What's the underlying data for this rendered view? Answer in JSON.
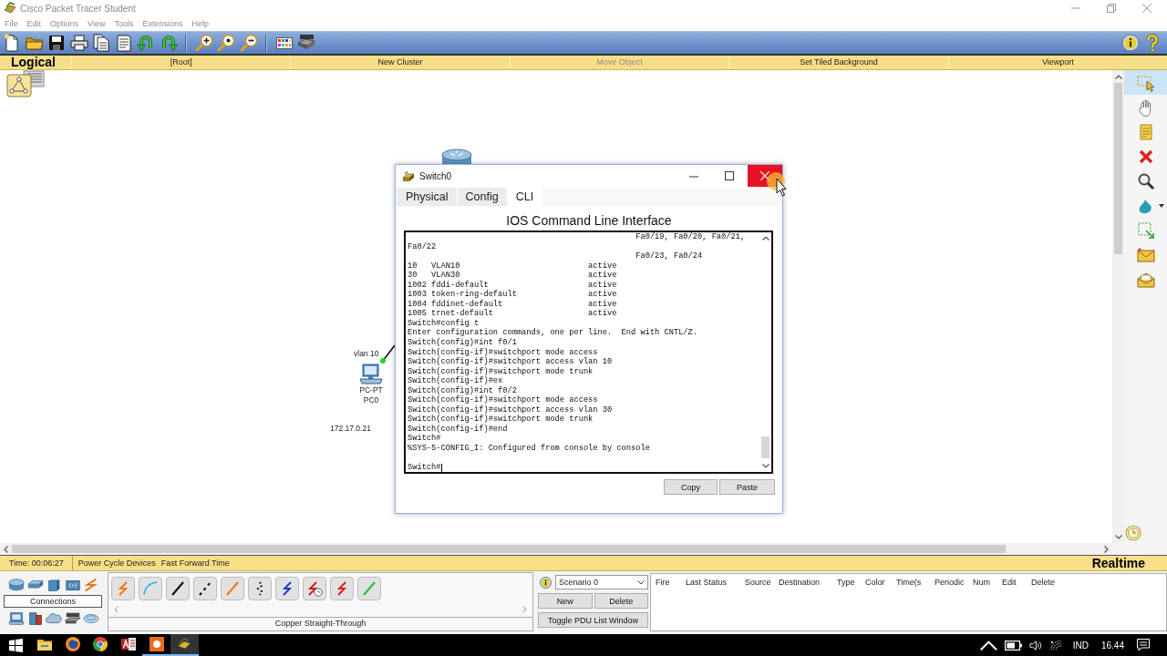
{
  "window": {
    "title": "Cisco Packet Tracer Student"
  },
  "menu": [
    "File",
    "Edit",
    "Options",
    "View",
    "Tools",
    "Extensions",
    "Help"
  ],
  "workspace_bar": {
    "mode_tab": "Logical",
    "items": [
      {
        "label": "[Root]",
        "disabled": false
      },
      {
        "label": "New Cluster",
        "disabled": false
      },
      {
        "label": "Move Object",
        "disabled": true
      },
      {
        "label": "Set Tiled Background",
        "disabled": false
      },
      {
        "label": "Viewport",
        "disabled": false
      }
    ]
  },
  "canvas": {
    "link_note": "vlan 10",
    "pc": {
      "model": "PC-PT",
      "name": "PC0"
    },
    "address_note": "172.17.0.21"
  },
  "tool_palette": [
    {
      "kind": "select",
      "selected": true
    },
    {
      "kind": "move",
      "selected": false
    },
    {
      "kind": "note",
      "selected": false
    },
    {
      "kind": "delete",
      "selected": false
    },
    {
      "kind": "inspect",
      "selected": false
    },
    {
      "kind": "draw",
      "selected": false
    },
    {
      "kind": "resize",
      "selected": false
    },
    {
      "kind": "simple-pdu",
      "selected": false
    },
    {
      "kind": "complex-pdu",
      "selected": false
    }
  ],
  "dialog": {
    "title": "Switch0",
    "tabs": [
      {
        "label": "Physical",
        "selected": false
      },
      {
        "label": "Config",
        "selected": false
      },
      {
        "label": "CLI",
        "selected": true
      }
    ],
    "heading": "IOS Command Line Interface",
    "console_lines": [
      "                                                Fa0/19, Fa0/20, Fa0/21,",
      "Fa0/22",
      "                                                Fa0/23, Fa0/24",
      "10   VLAN10                           active",
      "30   VLAN30                           active",
      "1002 fddi-default                     active",
      "1003 token-ring-default               active",
      "1004 fddinet-default                  active",
      "1005 trnet-default                    active",
      "Switch#config t",
      "Enter configuration commands, one per line.  End with CNTL/Z.",
      "Switch(config)#int f0/1",
      "Switch(config-if)#switchport mode access",
      "Switch(config-if)#switchport access vlan 10",
      "Switch(config-if)#switchport mode trunk",
      "Switch(config-if)#ex",
      "Switch(config)#int f0/2",
      "Switch(config-if)#switchport mode access",
      "Switch(config-if)#switchport access vlan 30",
      "Switch(config-if)#switchport mode trunk",
      "Switch(config-if)#end",
      "Switch#",
      "%SYS-5-CONFIG_I: Configured from console by console"
    ],
    "prompt": "Switch#",
    "buttons": [
      "Copy",
      "Paste"
    ]
  },
  "status_bar": {
    "time": "Time: 00:06:27",
    "buttons": [
      "Power Cycle Devices",
      "Fast Forward Time"
    ],
    "mode_tab": "Realtime"
  },
  "device_types": {
    "top_row": [
      {
        "kind": "router"
      },
      {
        "kind": "switch"
      },
      {
        "kind": "hub"
      },
      {
        "kind": "wireless"
      },
      {
        "kind": "connection"
      }
    ],
    "label": "Connections",
    "bottom_row": [
      {
        "kind": "end-device"
      },
      {
        "kind": "security"
      },
      {
        "kind": "wan"
      },
      {
        "kind": "custom"
      },
      {
        "kind": "multiuser"
      }
    ]
  },
  "cables": {
    "items": [
      {
        "kind": "automatic"
      },
      {
        "kind": "console"
      },
      {
        "kind": "copper-straight"
      },
      {
        "kind": "copper-cross"
      },
      {
        "kind": "fiber"
      },
      {
        "kind": "phone"
      },
      {
        "kind": "coaxial"
      },
      {
        "kind": "serial-dce"
      },
      {
        "kind": "serial-dte"
      },
      {
        "kind": "usb"
      }
    ],
    "name": "Copper Straight-Through"
  },
  "scenario": {
    "select": "Scenario 0",
    "buttons": [
      "New",
      "Delete",
      "Toggle PDU List Window"
    ]
  },
  "pdu_table": {
    "columns": [
      "Fire",
      "Last Status",
      "Source",
      "Destination",
      "Type",
      "Color",
      "Time(s",
      "Periodic",
      "Num",
      "Edit",
      "Delete"
    ]
  },
  "taskbar": {
    "apps": [
      {
        "kind": "folder",
        "running": false,
        "selected": false
      },
      {
        "kind": "globe",
        "running": false,
        "selected": false
      },
      {
        "kind": "ring",
        "running": false,
        "selected": false
      },
      {
        "kind": "red-tile",
        "running": false,
        "selected": false
      },
      {
        "kind": "orange-tile",
        "running": true,
        "selected": false
      },
      {
        "kind": "logo",
        "running": true,
        "selected": true
      }
    ],
    "language": "IND",
    "clock": "16.44"
  }
}
